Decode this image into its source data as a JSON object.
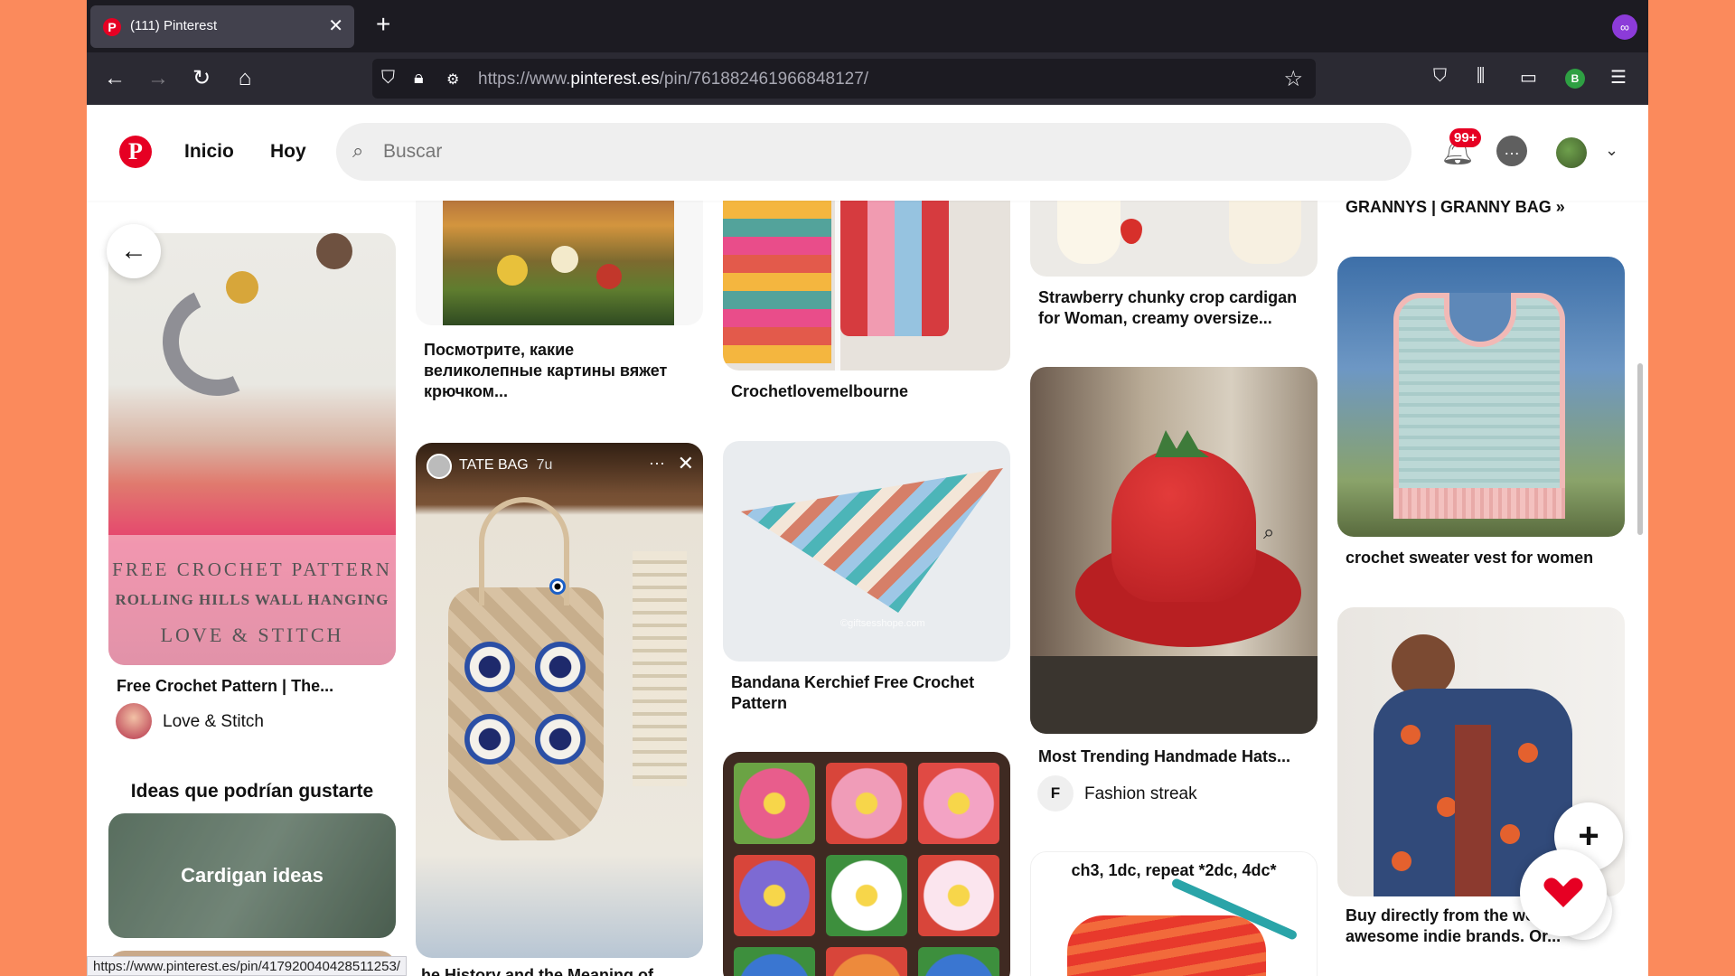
{
  "browser": {
    "tab_title": "(111) Pinterest",
    "url_prefix": "https://www.",
    "url_domain": "pinterest.es",
    "url_path": "/pin/761882461966848127/",
    "account_initial": "B",
    "status_url": "https://www.pinterest.es/pin/417920040428511253/"
  },
  "header": {
    "logo": "P",
    "nav": [
      "Inicio",
      "Hoy"
    ],
    "search_placeholder": "Buscar",
    "notification_badge": "99+"
  },
  "col1": {
    "pin_overlay": [
      "FREE CROCHET PATTERN",
      "ROLLING HILLS WALL HANGING",
      "LOVE & STITCH"
    ],
    "pin_title": "Free Crochet Pattern | The...",
    "creator": "Love & Stitch",
    "ideas_heading": "Ideas que podrían gustarte",
    "idea_card": "Cardigan ideas"
  },
  "col2": {
    "pin1_title": "Посмотрите, какие великолепные картины вяжет крючком...",
    "story_name": "TATE BAG",
    "story_time": "7u",
    "pin2_title_partial": "he History and the Meaning of"
  },
  "col3": {
    "pin1_title": "Crochetlovemelbourne",
    "pin2_title": "Bandana Kerchief Free Crochet Pattern",
    "pin2_watermark": "©giftsesshope.com"
  },
  "col4": {
    "pin1_title": "Strawberry chunky crop cardigan for Woman, creamy oversize...",
    "pin2_title": "Most Trending Handmade Hats...",
    "pin2_creator_initial": "F",
    "pin2_creator": "Fashion streak",
    "pin3_caption": "ch3, 1dc, repeat *2dc, 4dc*"
  },
  "col5": {
    "pin0_title": "GRANNYS | GRANNY BAG »",
    "pin1_title": "crochet sweater vest for women",
    "pin2_title": "Buy directly from the world awesome indie brands. Or..."
  },
  "fab": {
    "plus": "+",
    "help": "?"
  },
  "colors": {
    "pinterest_red": "#e60023",
    "background": "#fb8a5c"
  }
}
